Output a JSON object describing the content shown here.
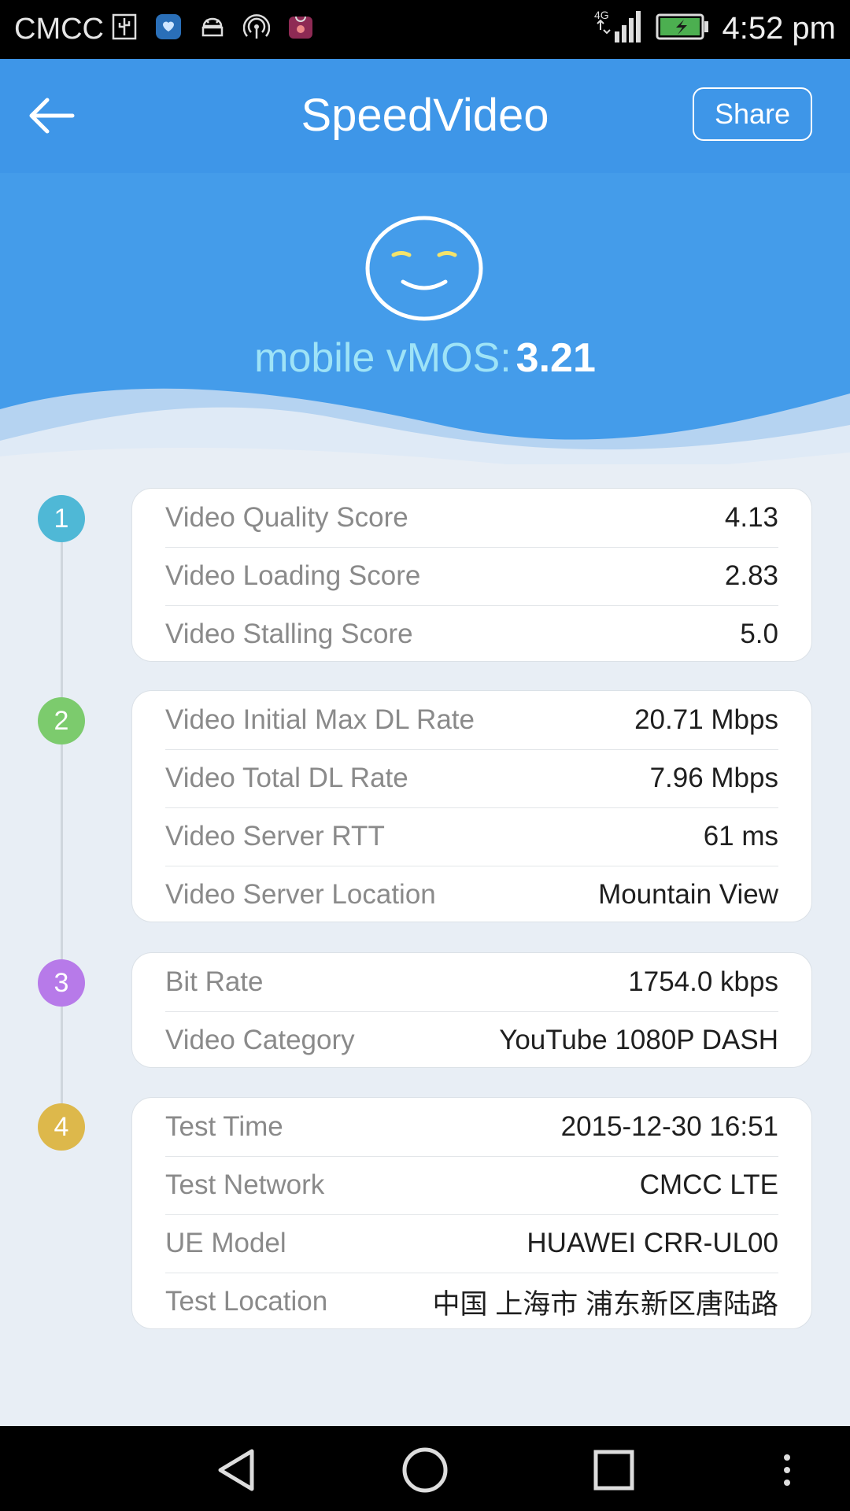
{
  "status_bar": {
    "carrier": "CMCC",
    "network": "4G",
    "time": "4:52 pm",
    "icons": [
      "usb-icon",
      "health-app-icon",
      "android-debug-icon",
      "hotspot-icon",
      "huawei-store-icon",
      "signal-icon",
      "battery-charging-icon"
    ]
  },
  "app_bar": {
    "title": "SpeedVideo",
    "share_label": "Share",
    "back_icon": "arrow-left-icon"
  },
  "hero": {
    "score_label": "mobile vMOS:",
    "score_value": "3.21",
    "face_icon": "smiley-face-icon"
  },
  "colors": {
    "header_blue": "#3e96e8",
    "hero_blue": "#449cea",
    "step1": "#4fb8d6",
    "step2": "#7ccb6d",
    "step3": "#b77ae9",
    "step4": "#ddb84b"
  },
  "sections": [
    {
      "step": "1",
      "rows": [
        {
          "label": "Video Quality Score",
          "value": "4.13"
        },
        {
          "label": "Video Loading Score",
          "value": "2.83"
        },
        {
          "label": "Video Stalling Score",
          "value": "5.0"
        }
      ]
    },
    {
      "step": "2",
      "rows": [
        {
          "label": "Video Initial Max DL Rate",
          "value": "20.71 Mbps"
        },
        {
          "label": "Video Total DL Rate",
          "value": "7.96 Mbps"
        },
        {
          "label": "Video Server RTT",
          "value": "61 ms"
        },
        {
          "label": "Video Server Location",
          "value": "Mountain View"
        }
      ]
    },
    {
      "step": "3",
      "rows": [
        {
          "label": "Bit Rate",
          "value": "1754.0 kbps"
        },
        {
          "label": "Video Category",
          "value": "YouTube 1080P DASH"
        }
      ]
    },
    {
      "step": "4",
      "rows": [
        {
          "label": "Test Time",
          "value": "2015-12-30 16:51"
        },
        {
          "label": "Test Network",
          "value": "CMCC LTE"
        },
        {
          "label": "UE Model",
          "value": "HUAWEI CRR-UL00"
        },
        {
          "label": "Test Location",
          "value": "中国 上海市 浦东新区唐陆路"
        }
      ]
    }
  ],
  "nav_bar": {
    "buttons": [
      "back-triangle-icon",
      "home-circle-icon",
      "recents-square-icon",
      "more-dots-icon"
    ]
  }
}
